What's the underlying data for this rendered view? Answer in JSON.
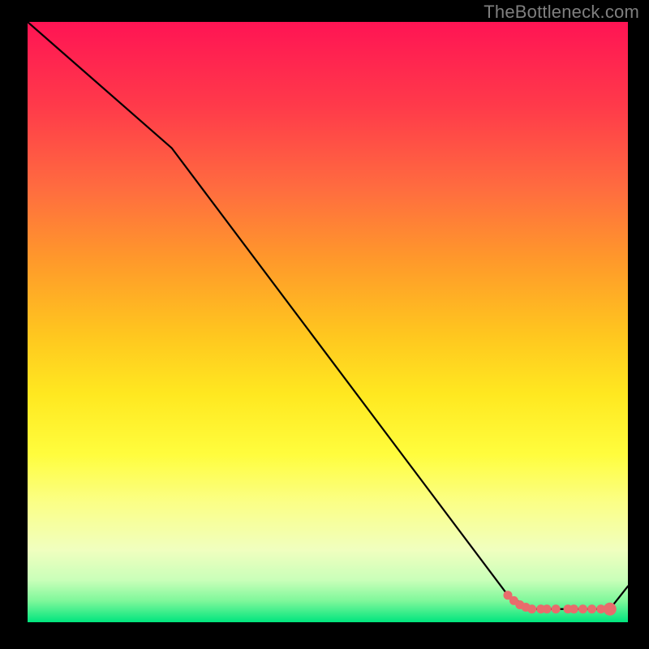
{
  "watermark": "TheBottleneck.com",
  "chart_data": {
    "type": "line",
    "title": "",
    "xlabel": "",
    "ylabel": "",
    "xlim": [
      0,
      100
    ],
    "ylim": [
      0,
      100
    ],
    "series": [
      {
        "name": "curve",
        "x": [
          0,
          24,
          80,
          84,
          92.5,
          97,
          100
        ],
        "y": [
          100,
          79,
          4.5,
          2.2,
          2.2,
          2.2,
          6
        ]
      }
    ],
    "markers": {
      "name": "highlighted-points",
      "color": "#e86c6c",
      "points": [
        {
          "x": 80.0,
          "y": 4.5
        },
        {
          "x": 81.0,
          "y": 3.6
        },
        {
          "x": 82.0,
          "y": 2.9
        },
        {
          "x": 83.0,
          "y": 2.5
        },
        {
          "x": 84.0,
          "y": 2.2
        },
        {
          "x": 85.5,
          "y": 2.2
        },
        {
          "x": 86.5,
          "y": 2.2
        },
        {
          "x": 88.0,
          "y": 2.2
        },
        {
          "x": 90.0,
          "y": 2.2
        },
        {
          "x": 91.0,
          "y": 2.2
        },
        {
          "x": 92.5,
          "y": 2.2
        },
        {
          "x": 94.0,
          "y": 2.2
        },
        {
          "x": 95.5,
          "y": 2.2
        },
        {
          "x": 97.0,
          "y": 2.2
        }
      ]
    },
    "gradient_stops": [
      {
        "pos": 0.0,
        "color": "#ff1454"
      },
      {
        "pos": 0.14,
        "color": "#ff3a4a"
      },
      {
        "pos": 0.28,
        "color": "#ff6d3f"
      },
      {
        "pos": 0.4,
        "color": "#ff9a2a"
      },
      {
        "pos": 0.52,
        "color": "#ffc61f"
      },
      {
        "pos": 0.62,
        "color": "#ffe820"
      },
      {
        "pos": 0.72,
        "color": "#fffd3d"
      },
      {
        "pos": 0.8,
        "color": "#fbff86"
      },
      {
        "pos": 0.88,
        "color": "#f0ffbf"
      },
      {
        "pos": 0.93,
        "color": "#c9ffb9"
      },
      {
        "pos": 0.965,
        "color": "#7df79a"
      },
      {
        "pos": 1.0,
        "color": "#00e57e"
      }
    ]
  }
}
